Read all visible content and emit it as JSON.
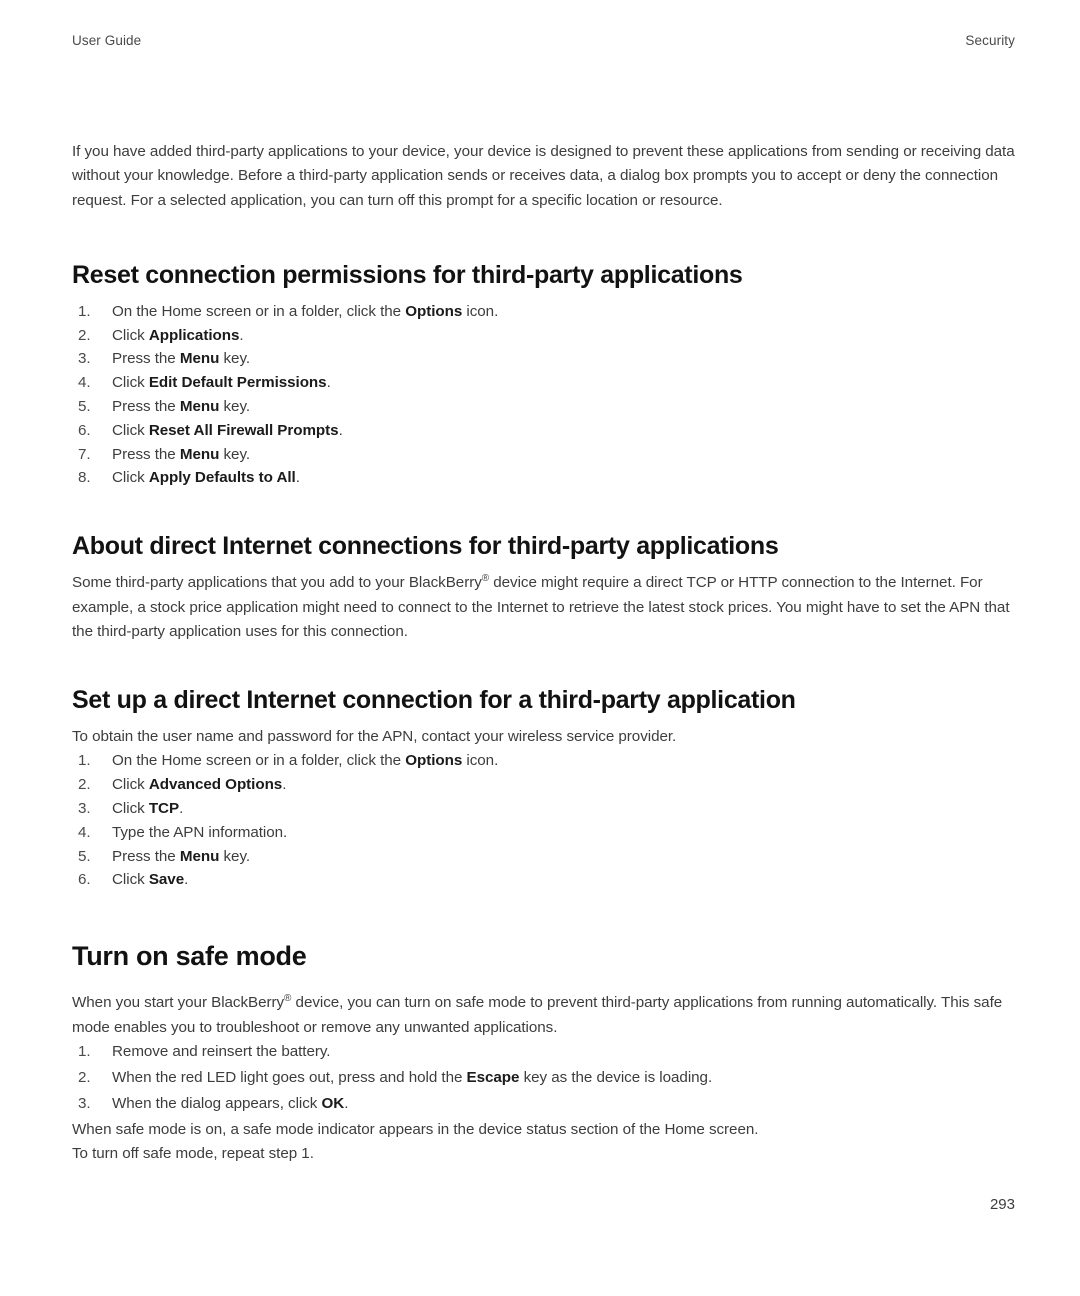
{
  "header": {
    "left": "User Guide",
    "right": "Security"
  },
  "intro_paragraph": "If you have added third-party applications to your device, your device is designed to prevent these applications from sending or receiving data without your knowledge. Before a third-party application sends or receives data, a dialog box prompts you to accept or deny the connection request. For a selected application, you can turn off this prompt for a specific location or resource.",
  "sections": {
    "reset_permissions": {
      "heading": "Reset connection permissions for third-party applications",
      "steps": [
        {
          "pre": "On the Home screen or in a folder, click the ",
          "bold": "Options",
          "post": " icon."
        },
        {
          "pre": "Click ",
          "bold": "Applications",
          "post": "."
        },
        {
          "pre": "Press the ",
          "bold": "Menu",
          "post": " key."
        },
        {
          "pre": "Click ",
          "bold": "Edit Default Permissions",
          "post": "."
        },
        {
          "pre": "Press the ",
          "bold": "Menu",
          "post": " key."
        },
        {
          "pre": "Click ",
          "bold": "Reset All Firewall Prompts",
          "post": "."
        },
        {
          "pre": "Press the ",
          "bold": "Menu",
          "post": " key."
        },
        {
          "pre": "Click ",
          "bold": "Apply Defaults to All",
          "post": "."
        }
      ]
    },
    "about_direct_internet": {
      "heading": "About direct Internet connections for third-party applications",
      "paragraph_part1": "Some third-party applications that you add to your BlackBerry",
      "paragraph_reg": "®",
      "paragraph_part2": " device might require a direct TCP or HTTP connection to the Internet. For example, a stock price application might need to connect to the Internet to retrieve the latest stock prices. You might have to set the APN that the third-party application uses for this connection."
    },
    "set_up_direct_internet": {
      "heading": "Set up a direct Internet connection for a third-party application",
      "lead_in": "To obtain the user name and password for the APN, contact your wireless service provider.",
      "steps": [
        {
          "pre": "On the Home screen or in a folder, click the ",
          "bold": "Options",
          "post": " icon."
        },
        {
          "pre": "Click ",
          "bold": "Advanced Options",
          "post": "."
        },
        {
          "pre": "Click ",
          "bold": "TCP",
          "post": "."
        },
        {
          "pre": "Type the APN information.",
          "bold": "",
          "post": ""
        },
        {
          "pre": "Press the ",
          "bold": "Menu",
          "post": " key."
        },
        {
          "pre": "Click ",
          "bold": "Save",
          "post": "."
        }
      ]
    },
    "turn_on_safe_mode": {
      "heading": "Turn on safe mode",
      "paragraph_part1": "When you start your BlackBerry",
      "paragraph_reg": "®",
      "paragraph_part2": " device, you can turn on safe mode to prevent third-party applications from running automatically. This safe mode enables you to troubleshoot or remove any unwanted applications.",
      "steps": [
        {
          "pre": "Remove and reinsert the battery.",
          "bold": "",
          "post": ""
        },
        {
          "pre": "When the red LED light goes out, press and hold the ",
          "bold": "Escape",
          "post": " key as the device is loading."
        },
        {
          "pre": "When the dialog appears, click ",
          "bold": "OK",
          "post": "."
        }
      ],
      "closing_paragraph_1": "When safe mode is on, a safe mode indicator appears in the device status section of the Home screen.",
      "closing_paragraph_2": "To turn off safe mode, repeat step 1."
    }
  },
  "page_number": "293"
}
